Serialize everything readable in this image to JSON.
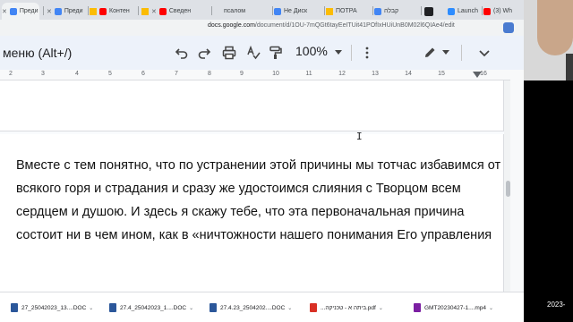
{
  "browser": {
    "tabs": [
      {
        "label": "Преди",
        "icon": "docs-icon",
        "color": "#4285f4",
        "active": true
      },
      {
        "label": "Преди",
        "icon": "docs-icon",
        "color": "#4285f4"
      },
      {
        "label": "Контен",
        "icon": "youtube-icon",
        "color": "#ff0000"
      },
      {
        "label": "Сведен",
        "icon": "drive-icon",
        "color": "#fbbc04"
      },
      {
        "label": "псалом",
        "icon": "youtube-icon",
        "color": "#ff0000"
      },
      {
        "label": "Не Диск",
        "icon": "docs-icon",
        "color": "#4285f4"
      },
      {
        "label": "ПОТРА",
        "icon": "drive-icon",
        "color": "#fbbc04"
      },
      {
        "label": "קבלה",
        "icon": "docs-icon",
        "color": "#4285f4"
      },
      {
        "label": "",
        "icon": "app-icon",
        "color": "#202124"
      },
      {
        "label": "Launch",
        "icon": "zoom-icon",
        "color": "#2d8cff"
      },
      {
        "label": "(3) Wh",
        "icon": "youtube-icon",
        "color": "#ff0000"
      }
    ],
    "address": {
      "host": "docs.google.com",
      "path": "/document/d/1OU-7mQGt6tayEeITUit41POfIxHUiUnB0M02l6QIAe4/edit"
    }
  },
  "toolbar": {
    "menu_search": "меню (Alt+/)",
    "zoom": "100%",
    "icons": [
      "undo-icon",
      "redo-icon",
      "print-icon",
      "spellcheck-icon",
      "paint-format-icon",
      "more-icon",
      "pen-icon",
      "collapse-icon"
    ]
  },
  "ruler": {
    "numbers": [
      "2",
      "3",
      "4",
      "5",
      "6",
      "7",
      "8",
      "9",
      "10",
      "11",
      "12",
      "13",
      "14",
      "15",
      "16"
    ]
  },
  "document": {
    "lines": [
      "Вместе с тем понятно, что по устранении этой причины мы тотчас избавимся от",
      "всякого горя и страдания и сразу же удостоимся слияния с Творцом всем",
      "сердцем и душою. И здесь я скажу тебе, что эта первоначальная причина",
      "состоит ни в чем ином, как в «ничтожности нашего понимания Его управления"
    ]
  },
  "downloads": [
    {
      "name": "27_25042023_13....DOC",
      "type": "doc"
    },
    {
      "name": "27.4_25042023_1....DOC",
      "type": "doc"
    },
    {
      "name": "27.4.23_2504202....DOC",
      "type": "doc"
    },
    {
      "name": "...ביתה א - טכניקה.pdf",
      "type": "pdf"
    },
    {
      "name": "GMT20230427-1....mp4",
      "type": "mp4"
    }
  ],
  "overlay": {
    "year": "2023-"
  },
  "colors": {
    "tab_bar": "#dee1e6",
    "toolbar_bg": "#edf2fa",
    "page_bg": "#ffffff"
  }
}
